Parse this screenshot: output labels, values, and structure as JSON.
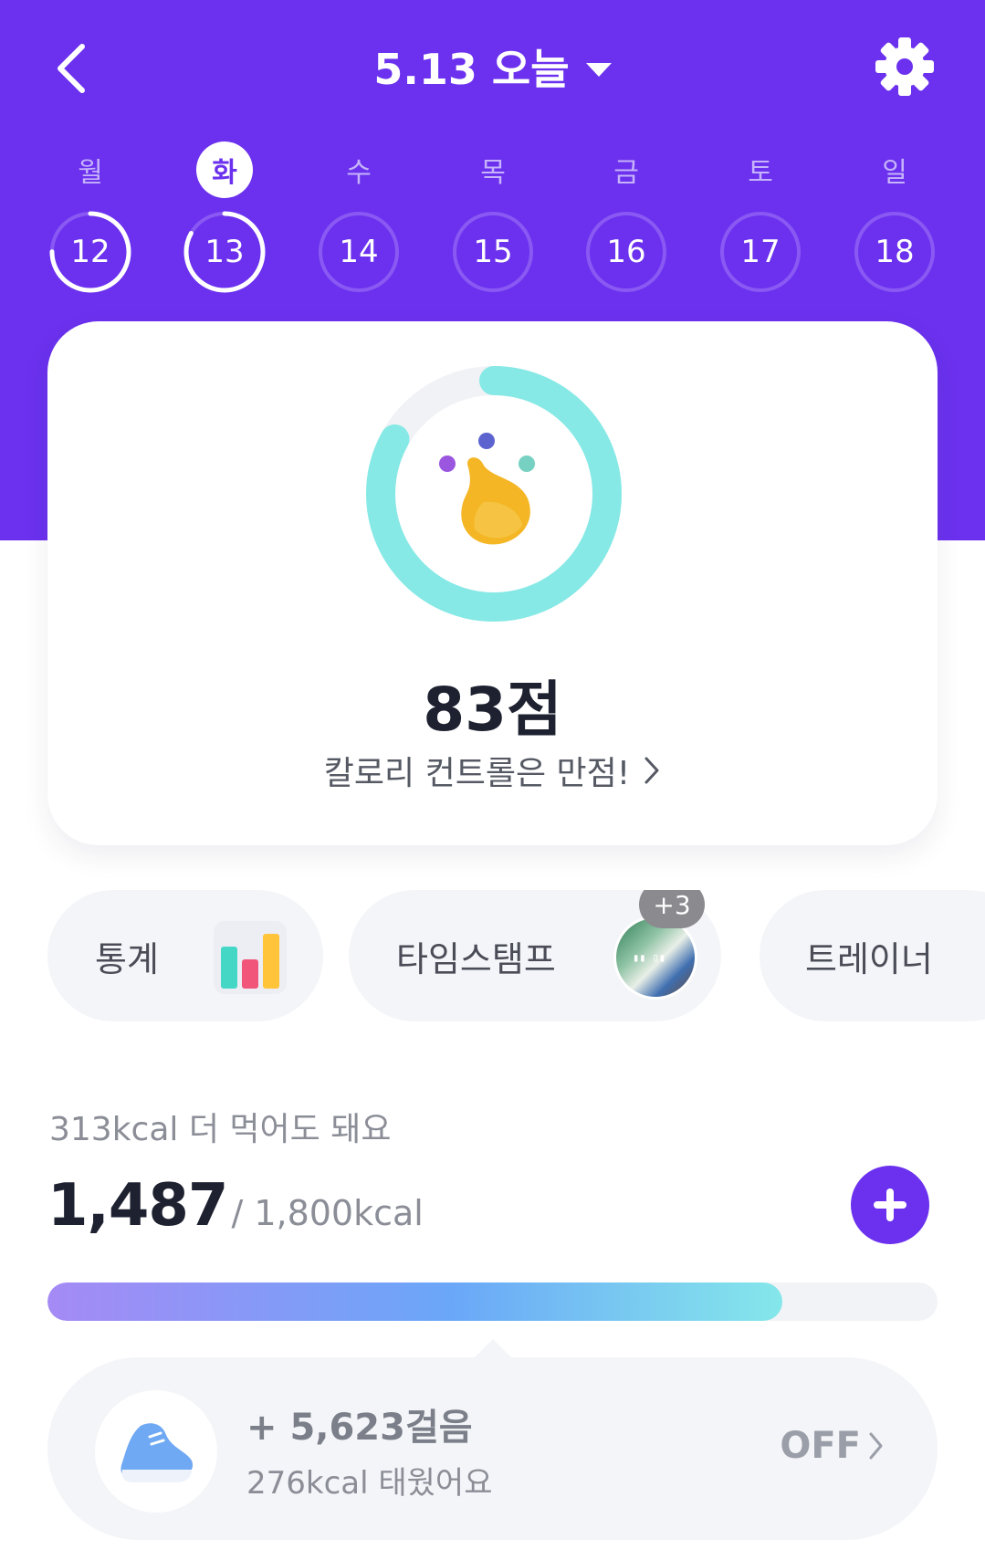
{
  "header": {
    "date_title": "5.13 오늘",
    "icons": {
      "back": "chevron-left-icon",
      "dropdown": "caret-down-icon",
      "settings": "gear-icon"
    }
  },
  "week": {
    "days": [
      {
        "label": "월",
        "date": "12",
        "active": false,
        "progress": 0.75
      },
      {
        "label": "화",
        "date": "13",
        "active": true,
        "progress": 0.83
      },
      {
        "label": "수",
        "date": "14",
        "active": false,
        "progress": 0
      },
      {
        "label": "목",
        "date": "15",
        "active": false,
        "progress": 0
      },
      {
        "label": "금",
        "date": "16",
        "active": false,
        "progress": 0
      },
      {
        "label": "토",
        "date": "17",
        "active": false,
        "progress": 0
      },
      {
        "label": "일",
        "date": "18",
        "active": false,
        "progress": 0
      }
    ]
  },
  "score_card": {
    "score": "83점",
    "score_fraction": 0.83,
    "message": "칼로리 컨트롤은 만점!",
    "ring_color": "#86e9e6"
  },
  "chips": {
    "stats_label": "통계",
    "timestamp_label": "타임스탬프",
    "timestamp_badge": "+3",
    "trainer_label": "트레이너"
  },
  "calories": {
    "remaining_text": "313kcal 더 먹어도 돼요",
    "intake": "1,487",
    "goal": "/ 1,800kcal",
    "progress_fraction": 0.826
  },
  "steps": {
    "count": "+ 5,623걸음",
    "burned": "276kcal 태웠어요",
    "toggle": "OFF"
  },
  "colors": {
    "brand": "#6b31ee",
    "accent_teal": "#86e9e6"
  }
}
